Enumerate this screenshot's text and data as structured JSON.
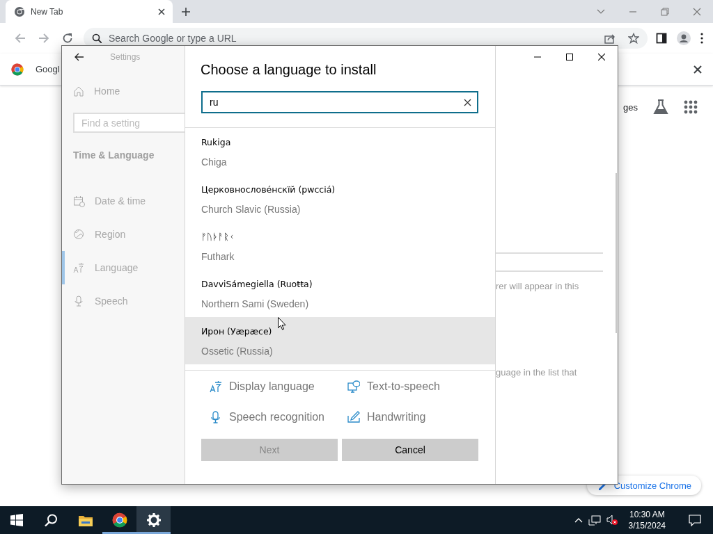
{
  "browser": {
    "tabs": [
      {
        "label": "New Tab",
        "selected": true
      }
    ],
    "omnibox": {
      "placeholder": "Search Google or type a URL"
    },
    "info_bar": {
      "text": "Googl"
    },
    "new_tab_page": {
      "link": "ges",
      "customize_button": "Customize Chrome"
    }
  },
  "settings_window": {
    "title": "Settings",
    "home": "Home",
    "search": {
      "placeholder": "Find a setting"
    },
    "section": "Time & Language",
    "nav": [
      {
        "label": "Date & time",
        "selected": false
      },
      {
        "label": "Region",
        "selected": false
      },
      {
        "label": "Language",
        "selected": true
      },
      {
        "label": "Speech",
        "selected": false
      }
    ],
    "background_texts": [
      "rer will appear in this",
      "guage in the list that"
    ]
  },
  "dialog": {
    "title": "Choose a language to install",
    "search": {
      "value": "ru"
    },
    "languages": [
      {
        "native": "Rukiga",
        "english": "Chiga",
        "selected": false
      },
      {
        "native": "Церковнословéнскїй (рwссіá)",
        "english": "Church Slavic (Russia)",
        "selected": false
      },
      {
        "native": "ᚠᚢᚦᚨᚱᚲ",
        "english": "Futhark",
        "selected": false
      },
      {
        "native": "DavviSámegiella (Ruoŧŧa)",
        "english": "Northern Sami (Sweden)",
        "selected": false
      },
      {
        "native": "Ирон (Уæрæсе)",
        "english": "Ossetic (Russia)",
        "selected": true
      }
    ],
    "features": [
      "Display language",
      "Text-to-speech",
      "Speech recognition",
      "Handwriting"
    ],
    "buttons": [
      {
        "label": "Next",
        "disabled": true
      },
      {
        "label": "Cancel",
        "disabled": false
      }
    ]
  },
  "taskbar": {
    "apps": [
      {
        "running": false,
        "selected": false
      },
      {
        "running": false,
        "selected": false
      },
      {
        "running": false,
        "selected": false
      },
      {
        "running": true,
        "selected": false
      },
      {
        "running": true,
        "selected": true
      }
    ],
    "time": "10:30 AM",
    "date": "3/15/2024"
  }
}
